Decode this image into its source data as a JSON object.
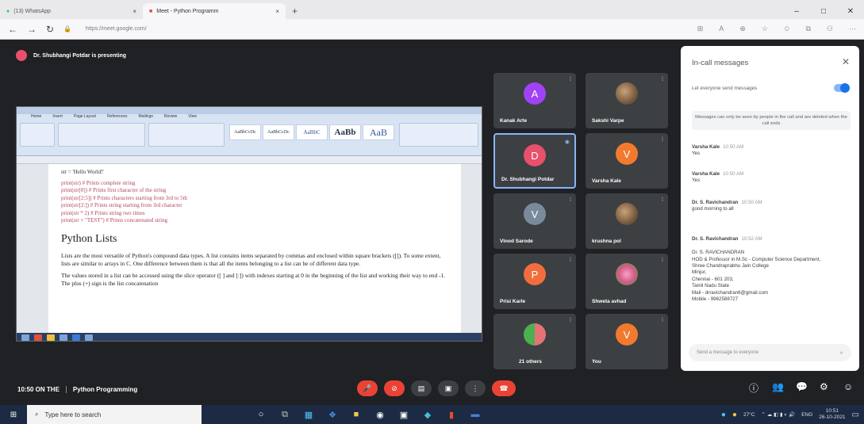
{
  "browser": {
    "tabs": [
      {
        "label": "(13) WhatsApp",
        "close": "×"
      },
      {
        "label": "Meet - Python Programm",
        "close": "×"
      }
    ],
    "new_tab": "+",
    "window_controls": [
      "–",
      "□",
      "✕"
    ],
    "url": "https://meet.google.com/",
    "nav": {
      "back": "←",
      "forward": "→",
      "reload": "↻"
    }
  },
  "presenting": {
    "initial": "D",
    "text": "Dr. Shubhangi Potdar is presenting"
  },
  "shared_doc": {
    "ribbon_tabs": [
      "Home",
      "Insert",
      "Page Layout",
      "References",
      "Mailings",
      "Review",
      "View"
    ],
    "styles": [
      "AaBbCcDc",
      "AaBbCcDc",
      "AaBbC",
      "AaBb",
      "AaB"
    ],
    "code_lines": [
      "str = 'Hello World!'",
      "print(str)  # Prints complete string",
      "print(str[0])  # Prints first character of the string",
      "print(str[2:5])  # Prints characters starting from 3rd to 5th",
      "print(str[2:])  # Prints string starting from 3rd character",
      "print(str * 2)  # Prints string two times",
      "print(str + \"TEST\")  # Prints concatenated string"
    ],
    "heading": "Python Lists",
    "para1": "Lists are the most versatile of Python's compound data types. A list contains items separated by commas and enclosed within square brackets ([]). To some extent, lists are similar to arrays in C. One difference between them is that all the items belonging to a list can be of different data type.",
    "para2": "The values stored in a list can be accessed using the slice operator ([ ] and [:]) with indexes starting at 0 in the beginning of the list and working their way to end -1. The plus (+) sign is the list concatenation"
  },
  "participants": [
    {
      "name": "Kanak Arte",
      "initial": "A",
      "color": "#a142f4",
      "kind": "initial"
    },
    {
      "name": "Sakshi Varpe",
      "initial": "",
      "color": "#5f6368",
      "kind": "photo"
    },
    {
      "name": "Dr. Shubhangi Potdar",
      "initial": "D",
      "color": "#e8506b",
      "kind": "initial",
      "active": true
    },
    {
      "name": "Varsha Kale",
      "initial": "V",
      "color": "#f27a2e",
      "kind": "initial"
    },
    {
      "name": "Vinod Sarode",
      "initial": "V",
      "color": "#7a8a9c",
      "kind": "initial"
    },
    {
      "name": "krushna pol",
      "initial": "",
      "color": "#5f6368",
      "kind": "photo"
    },
    {
      "name": "Prisi Karle",
      "initial": "P",
      "color": "#f26d3d",
      "kind": "initial"
    },
    {
      "name": "Shweta avhad",
      "initial": "",
      "color": "#5f6368",
      "kind": "flower"
    },
    {
      "name": "21 others",
      "initial": "",
      "color": "#5f6368",
      "kind": "others"
    },
    {
      "name": "You",
      "initial": "V",
      "color": "#f27a2e",
      "kind": "initial"
    }
  ],
  "chat": {
    "title": "In-call messages",
    "toggle_label": "Let everyone send messages",
    "note": "Messages can only be seen by people in the call and are deleted when the call ends",
    "messages": [
      {
        "who": "Varsha Kale",
        "when": "10:50 AM",
        "text": "Yes"
      },
      {
        "who": "Varsha Kale",
        "when": "10:50 AM",
        "text": "Yes"
      },
      {
        "who": "Dr. S. Ravichandran",
        "when": "10:50 AM",
        "text": "good morning to all"
      },
      {
        "who": "Dr. S. Ravichandran",
        "when": "10:52 AM",
        "text": "Dr. S. RAVICHANDRAN\nHOD & Professor in M.Sc - Computer Science Department,\nShree Chandraprabhu Jain College\nMinjur,\nChennai - 601 203,\nTamil Nadu State\nMail - drravichandran6@gmail.com\nMobile - 9962588727"
      }
    ],
    "input_placeholder": "Send a message to everyone",
    "send": "➤"
  },
  "meeting": {
    "time": "10:50 ON THE",
    "name": "Python Programming"
  },
  "controls": [
    {
      "icon": "🎤",
      "color": "#ea4335"
    },
    {
      "icon": "⊘",
      "color": "#ea4335"
    },
    {
      "icon": "▤",
      "color": "#3c4043"
    },
    {
      "icon": "▣",
      "color": "#3c4043"
    },
    {
      "icon": "⋮",
      "color": "#3c4043"
    },
    {
      "icon": "☎",
      "color": "#ea4335"
    }
  ],
  "right_controls": [
    "ⓘ",
    "👥",
    "💬",
    "⚙",
    "☺"
  ],
  "taskbar": {
    "search_placeholder": "Type here to search",
    "weather": "27°C",
    "lang": "ENG",
    "time": "10:51",
    "date": "26-10-2021"
  }
}
